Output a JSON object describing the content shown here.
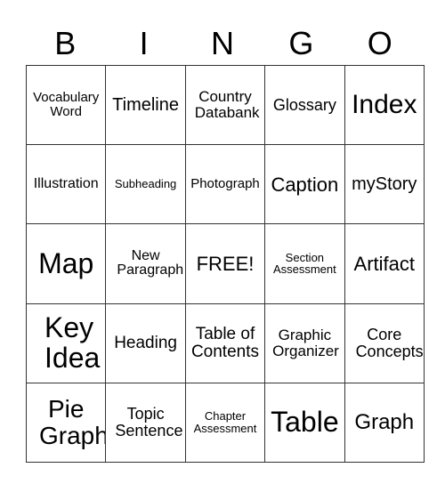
{
  "header": [
    "B",
    "I",
    "N",
    "G",
    "O"
  ],
  "rows": [
    [
      "Vocabulary Word",
      "Timeline",
      "Country Databank",
      "Glossary",
      "Index"
    ],
    [
      "Illustration",
      "Subheading",
      "Photograph",
      "Caption",
      "myStory"
    ],
    [
      "Map",
      "New Paragraph",
      "FREE!",
      "Section Assessment",
      "Artifact"
    ],
    [
      "Key Idea",
      "Heading",
      "Table of Contents",
      "Graphic Organizer",
      "Core Concepts"
    ],
    [
      "Pie Graph",
      "Topic Sentence",
      "Chapter Assessment",
      "Table",
      "Graph"
    ]
  ]
}
